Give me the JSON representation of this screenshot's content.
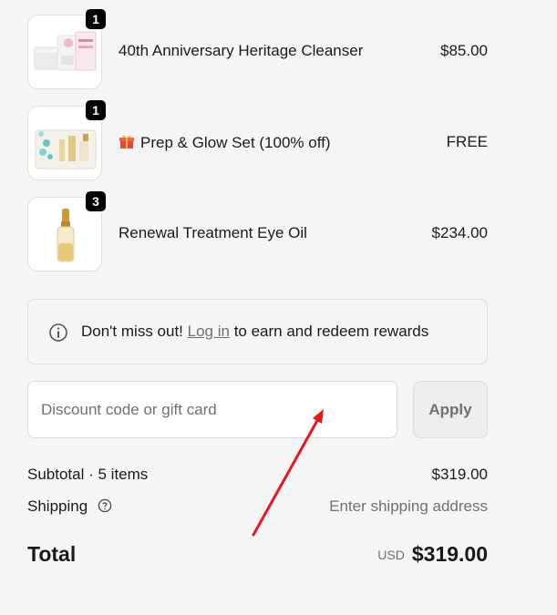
{
  "items": [
    {
      "name": "40th Anniversary Heritage Cleanser",
      "price": "$85.00",
      "quantity": "1",
      "gift": false
    },
    {
      "name": "Prep & Glow Set (100% off)",
      "price": "FREE",
      "quantity": "1",
      "gift": true
    },
    {
      "name": "Renewal Treatment Eye Oil",
      "price": "$234.00",
      "quantity": "3",
      "gift": false
    }
  ],
  "notice": {
    "prefix": "Don't miss out!",
    "link": "Log in",
    "suffix": "to earn and redeem rewards"
  },
  "discount": {
    "placeholder": "Discount code or gift card",
    "value": "",
    "apply_label": "Apply"
  },
  "summary": {
    "subtotal_label": "Subtotal · 5 items",
    "subtotal_value": "$319.00",
    "shipping_label": "Shipping",
    "shipping_value": "Enter shipping address",
    "total_label": "Total",
    "currency": "USD",
    "total_value": "$319.00"
  },
  "colors": {
    "background": "#f5f5f5",
    "annotation_arrow": "#e8171b"
  }
}
